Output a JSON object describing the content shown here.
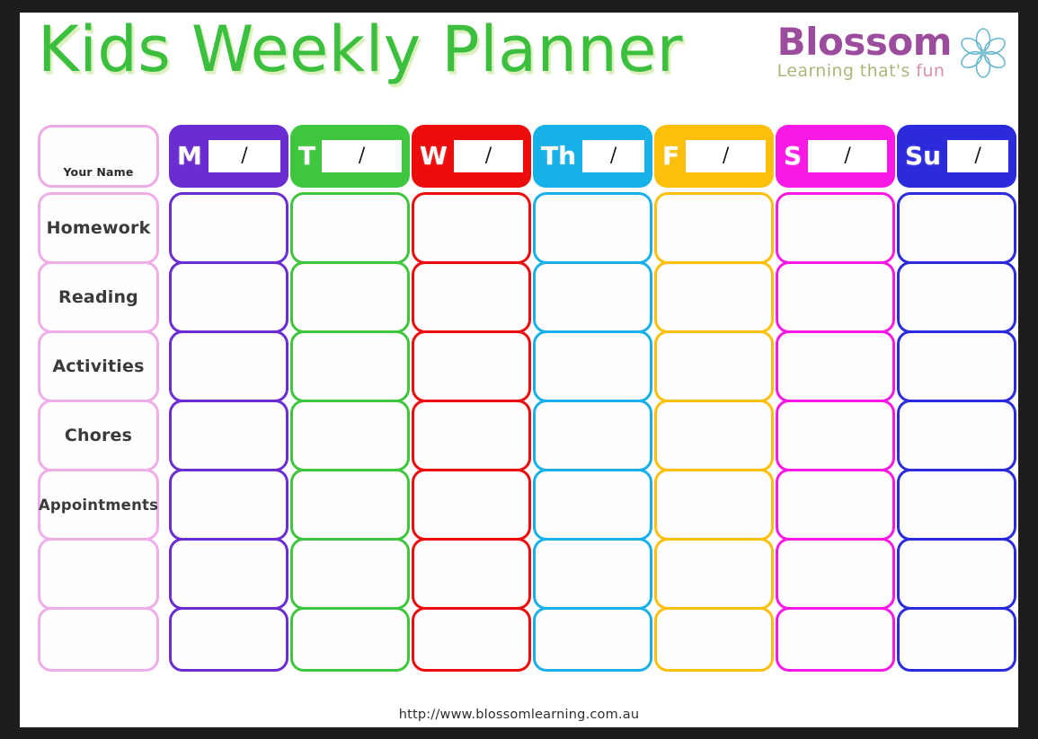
{
  "page": {
    "title": "Kids Weekly Planner",
    "background_color": "#ffffff",
    "frame_color": "#1e1c1d",
    "title_color": "#3cbf3e"
  },
  "brand": {
    "name": "Blossom",
    "name_color": "#9c4c9c",
    "tagline_part1": "Learning that's",
    "tagline_part2": "fun",
    "tagline_color": "#a9b87a",
    "tagline_accent_color": "#d98fae",
    "icon": "flower-icon",
    "icon_color": "#5fb6cf"
  },
  "name_cell": {
    "label": "Your Name",
    "border_color": "#ecabe4"
  },
  "days": [
    {
      "abbr": "M",
      "full": "Monday",
      "date": "/",
      "color": "#6a2dd0"
    },
    {
      "abbr": "T",
      "full": "Tuesday",
      "date": "/",
      "color": "#3ec63e"
    },
    {
      "abbr": "W",
      "full": "Wednesday",
      "date": "/",
      "color": "#ed0c0c"
    },
    {
      "abbr": "Th",
      "full": "Thursday",
      "date": "/",
      "color": "#18b0e8"
    },
    {
      "abbr": "F",
      "full": "Friday",
      "date": "/",
      "color": "#fbbf0c"
    },
    {
      "abbr": "S",
      "full": "Saturday",
      "date": "/",
      "color": "#f919e4"
    },
    {
      "abbr": "Su",
      "full": "Sunday",
      "date": "/",
      "color": "#2b2bdb"
    }
  ],
  "rows": [
    {
      "label": "Homework",
      "small": false
    },
    {
      "label": "Reading",
      "small": false
    },
    {
      "label": "Activities",
      "small": false
    },
    {
      "label": "Chores",
      "small": false
    },
    {
      "label": "Appointments",
      "small": true
    },
    {
      "label": "",
      "small": false
    },
    {
      "label": "",
      "small": false
    }
  ],
  "row_label_border_color": "#eeaeea",
  "footer": {
    "url": "http://www.blossomlearning.com.au"
  }
}
